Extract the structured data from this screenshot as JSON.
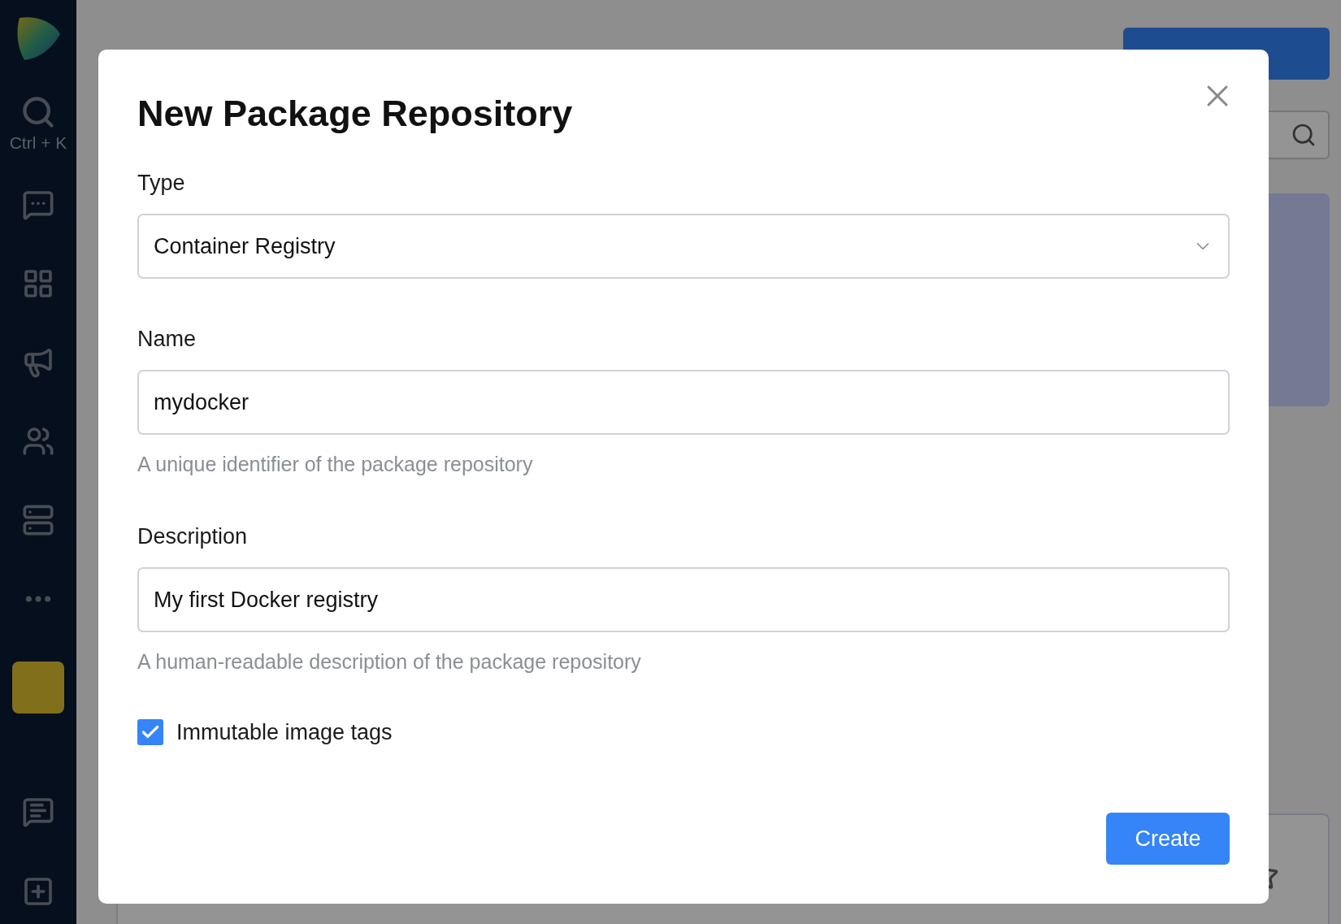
{
  "sidebar": {
    "search_shortcut": "Ctrl + K",
    "items": [
      {
        "kind": "chat"
      },
      {
        "kind": "widgets"
      },
      {
        "kind": "megaphone"
      },
      {
        "kind": "people"
      },
      {
        "kind": "list"
      },
      {
        "kind": "more"
      }
    ],
    "bottom_items": [
      {
        "kind": "comment"
      },
      {
        "kind": "add"
      }
    ]
  },
  "dialog": {
    "title": "New Package Repository",
    "fields": [
      {
        "kind": "select",
        "label": "Type",
        "value": "Container Registry"
      },
      {
        "kind": "text",
        "label": "Name",
        "value": "mydocker",
        "hint": "A unique identifier of the package repository"
      },
      {
        "kind": "text",
        "label": "Description",
        "value": "My first Docker registry",
        "hint": "A human-readable description of the package repository"
      }
    ],
    "checkbox": {
      "label": "Immutable image tags",
      "checked": true
    },
    "submit": "Create"
  }
}
